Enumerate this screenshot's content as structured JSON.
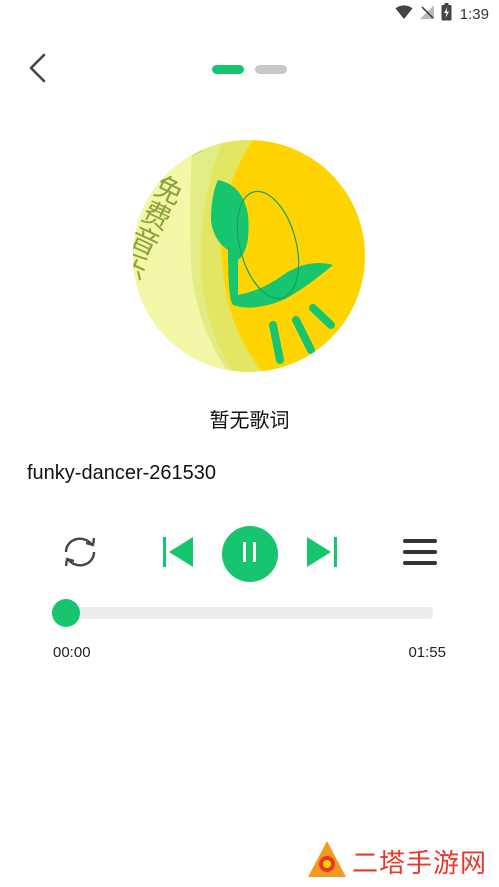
{
  "status_bar": {
    "time": "1:39",
    "battery_icon": "battery-charging-icon",
    "wifi_icon": "wifi-icon",
    "signal_icon": "signal-off-icon"
  },
  "header": {
    "back_icon": "chevron-left-icon",
    "page_count": 2,
    "active_page": 0
  },
  "cover": {
    "text": "免费音乐"
  },
  "lyrics": {
    "text": "暂无歌词"
  },
  "song": {
    "title": "funky-dancer-261530"
  },
  "controls": {
    "loop_icon": "repeat-icon",
    "prev_icon": "skip-previous-icon",
    "play_state_icon": "pause-icon",
    "next_icon": "skip-next-icon",
    "playlist_icon": "menu-icon"
  },
  "progress": {
    "current": "00:00",
    "total": "01:55",
    "fraction": 0.0
  },
  "watermark": {
    "text": "二塔手游网"
  },
  "colors": {
    "accent": "#16c56e",
    "inactive_dot": "#c8c8c8",
    "track": "#ededed"
  }
}
